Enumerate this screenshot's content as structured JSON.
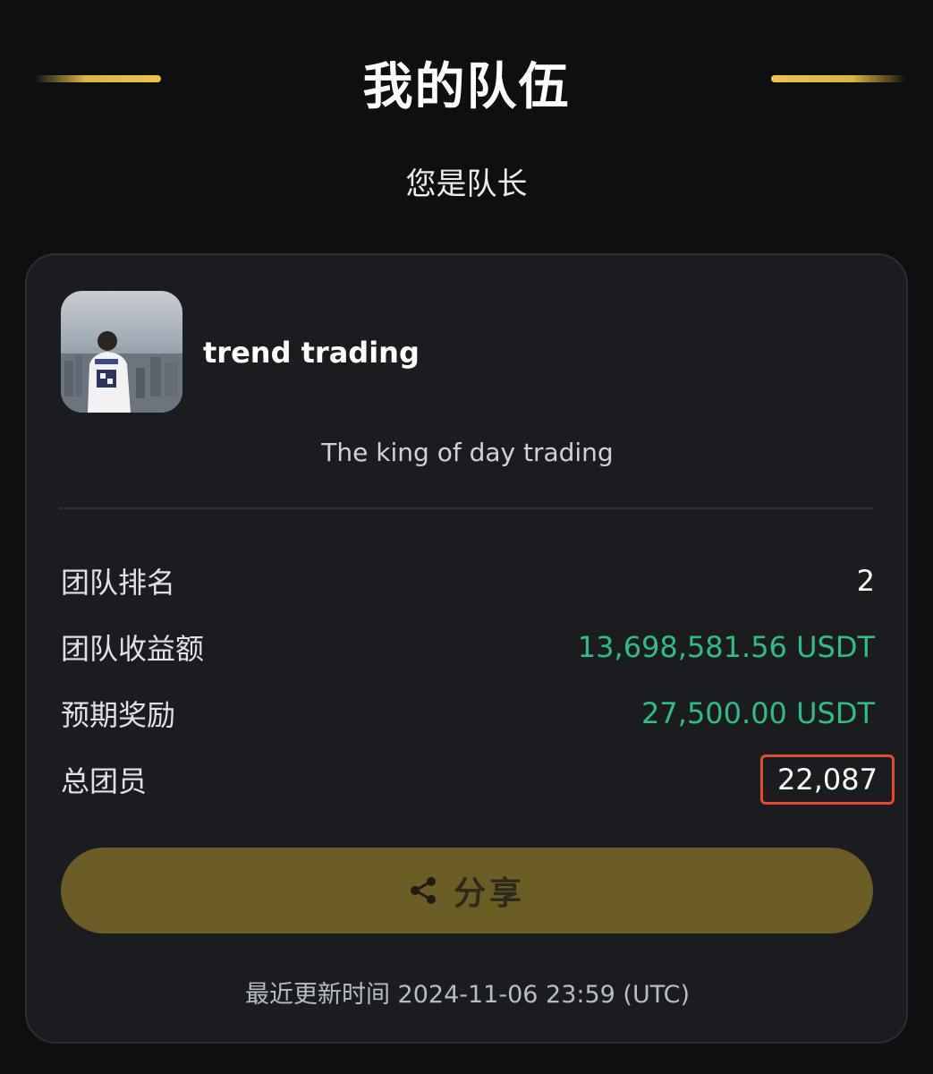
{
  "header": {
    "title": "我的队伍",
    "subtitle": "您是队长",
    "accent_color": "#f0c34a"
  },
  "team": {
    "name": "trend trading",
    "motto": "The king of day trading",
    "avatar_icon": "team-avatar-photo"
  },
  "stats": [
    {
      "label": "团队排名",
      "value": "2"
    },
    {
      "label": "团队收益额",
      "value": "13,698,581.56 USDT",
      "color": "#2ebd85"
    },
    {
      "label": "预期奖励",
      "value": "27,500.00 USDT",
      "color": "#2ebd85"
    },
    {
      "label": "总团员",
      "value": "22,087",
      "highlight_color": "#e24c2c"
    }
  ],
  "share_button": {
    "label": "分享",
    "icon": "share-icon",
    "color": "#6b5d23"
  },
  "footer": {
    "update_time": "最近更新时间 2024-11-06 23:59 (UTC)"
  }
}
